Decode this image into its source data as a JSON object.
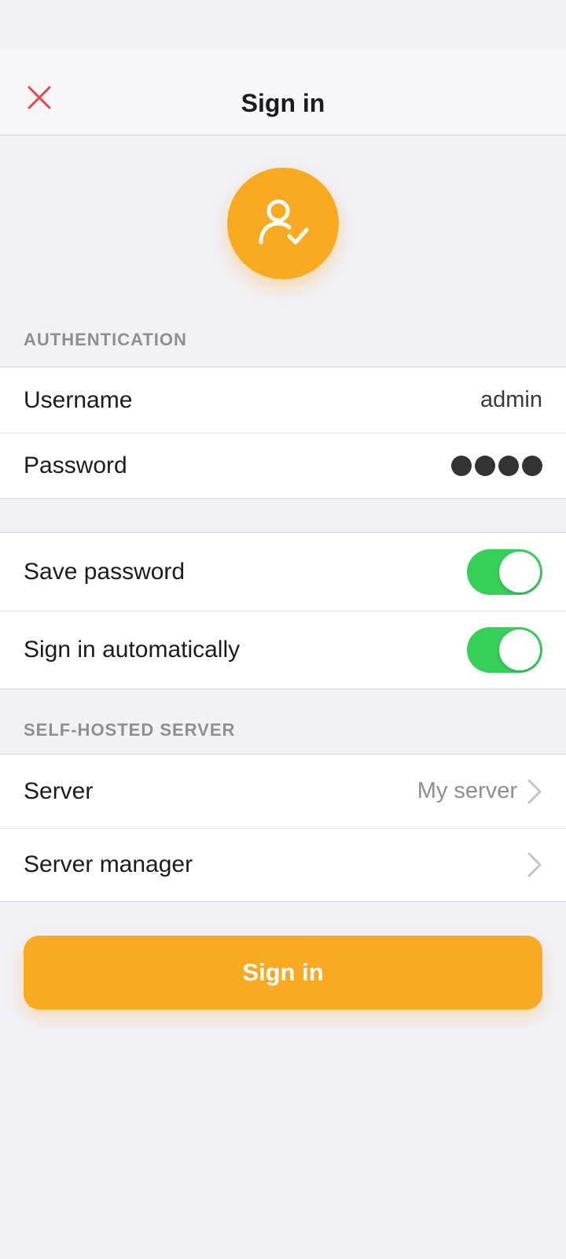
{
  "nav": {
    "title": "Sign in",
    "close_icon": "close-icon"
  },
  "avatar": {
    "icon": "user-check-icon",
    "color": "#f9aa20"
  },
  "authentication": {
    "header": "AUTHENTICATION",
    "username_label": "Username",
    "username_value": "admin",
    "password_label": "Password",
    "password_masked_length": 4
  },
  "options": {
    "save_password_label": "Save password",
    "save_password_on": true,
    "sign_in_auto_label": "Sign in automatically",
    "sign_in_auto_on": true,
    "toggle_color": "#34d058"
  },
  "self_hosted": {
    "header": "SELF-HOSTED SERVER",
    "server_label": "Server",
    "server_value": "My server",
    "server_manager_label": "Server manager"
  },
  "actions": {
    "sign_in_button": "Sign in",
    "accent_color": "#f9aa20"
  }
}
